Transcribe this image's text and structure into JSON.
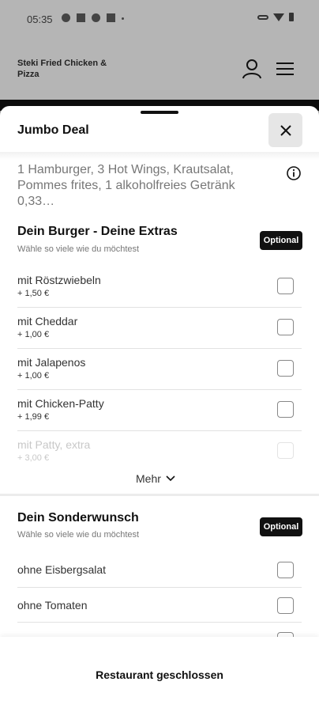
{
  "status_bar": {
    "time": "05:35"
  },
  "app_header": {
    "restaurant_name": "Steki Fried Chicken & Pizza"
  },
  "sheet": {
    "title": "Jumbo Deal",
    "description": "1 Hamburger, 3 Hot Wings, Krautsalat, Pommes frites, 1 alkoholfreies Getränk 0,33…"
  },
  "sections": [
    {
      "title": "Dein Burger - Deine Extras",
      "subtitle": "Wähle so viele wie du möchtest",
      "badge": "Optional",
      "options": [
        {
          "label": "mit Röstzwiebeln",
          "price": "+ 1,50 €",
          "checked": false
        },
        {
          "label": "mit Cheddar",
          "price": "+ 1,00 €",
          "checked": false
        },
        {
          "label": "mit Jalapenos",
          "price": "+ 1,00 €",
          "checked": false
        },
        {
          "label": "mit Chicken-Patty",
          "price": "+ 1,99 €",
          "checked": false
        },
        {
          "label": "mit Patty, extra",
          "price": "+ 3,00 €",
          "checked": false
        }
      ],
      "more_label": "Mehr"
    },
    {
      "title": "Dein Sonderwunsch",
      "subtitle": "Wähle so viele wie du möchtest",
      "badge": "Optional",
      "options": [
        {
          "label": "ohne Eisbergsalat",
          "checked": false
        },
        {
          "label": "ohne Tomaten",
          "checked": false
        }
      ]
    }
  ],
  "footer": {
    "status_text": "Restaurant geschlossen"
  }
}
